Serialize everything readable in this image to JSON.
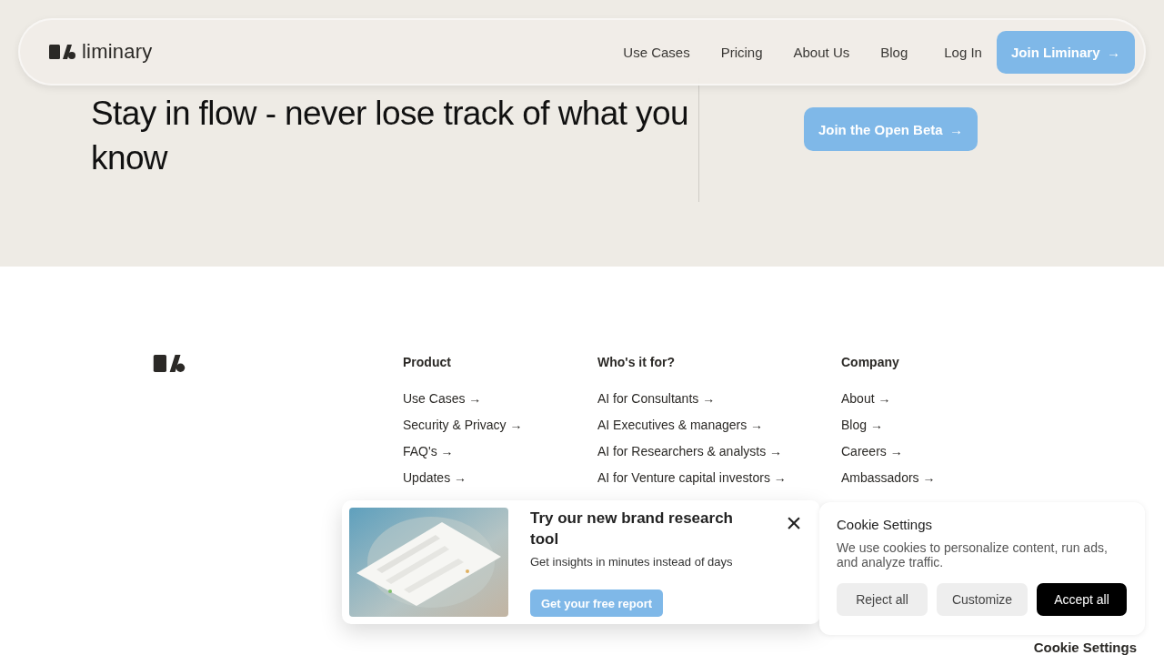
{
  "nav": {
    "brand": "liminary",
    "links": [
      {
        "label": "Use Cases"
      },
      {
        "label": "Pricing"
      },
      {
        "label": "About Us"
      },
      {
        "label": "Blog"
      }
    ],
    "login": "Log In",
    "cta": "Join Liminary",
    "cta_arrow": "→"
  },
  "hero": {
    "heading": "Stay in flow - never lose track of what you know",
    "button": "Join the Open Beta",
    "button_arrow": "→"
  },
  "footer": {
    "columns": [
      {
        "title": "Product",
        "links": [
          "Use Cases →",
          "Security & Privacy →",
          "FAQ's →",
          "Updates →"
        ]
      },
      {
        "title": "Who's it for?",
        "links": [
          "AI for Consultants →",
          "AI Executives & managers →",
          "AI for Researchers & analysts →",
          "AI for Venture capital investors →"
        ]
      },
      {
        "title": "Company",
        "links": [
          "About →",
          "Blog →",
          "Careers →",
          "Ambassadors →"
        ]
      }
    ]
  },
  "promo": {
    "title": "Try our new brand research tool",
    "text": "Get insights in minutes instead of days",
    "button": "Get your free report",
    "close": "×"
  },
  "cookie": {
    "title": "Cookie Settings",
    "text": "We use cookies to personalize content, run ads, and analyze traffic.",
    "buttons": [
      {
        "label": "Reject all",
        "kind": "secondary"
      },
      {
        "label": "Customize",
        "kind": "secondary"
      },
      {
        "label": "Accept all",
        "kind": "primary"
      }
    ]
  },
  "cookie_link": "Cookie Settings"
}
